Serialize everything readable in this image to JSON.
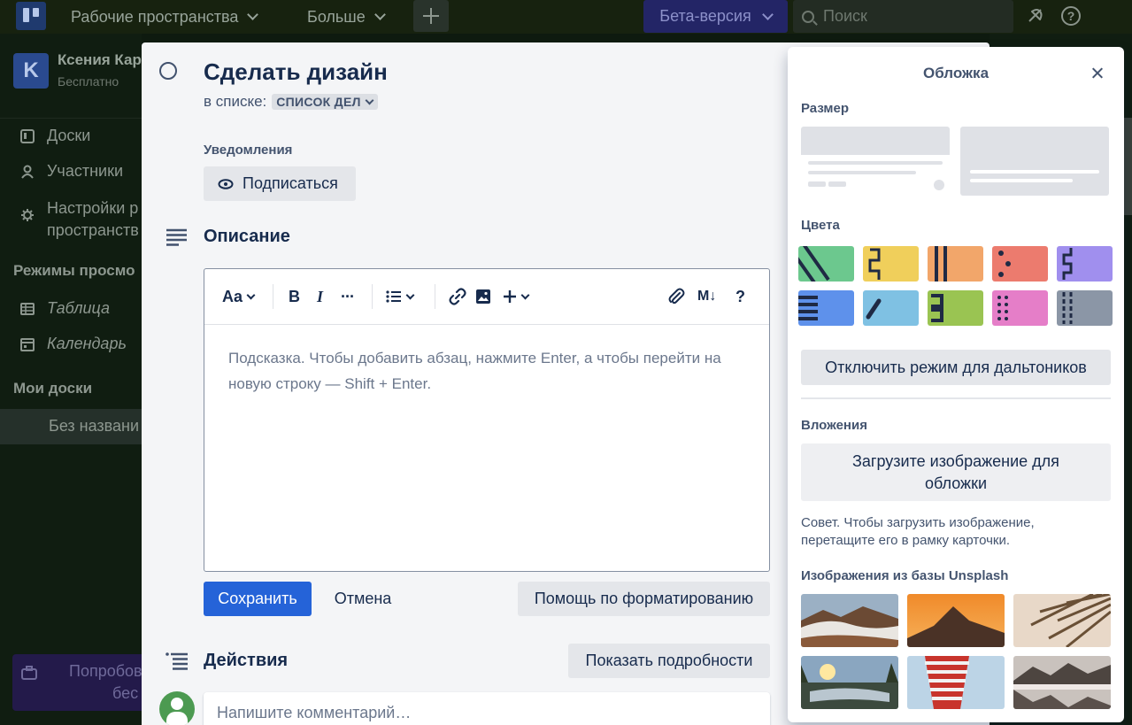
{
  "topbar": {
    "workspaces_label": "Рабочие пространства",
    "more_label": "Больше",
    "beta_label": "Бета-версия",
    "search_placeholder": "Поиск"
  },
  "sidebar": {
    "workspace_initial": "K",
    "workspace_name": "Ксения Кар",
    "workspace_plan": "Бесплатно",
    "items": [
      {
        "label": "Доски"
      },
      {
        "label": "Участники"
      },
      {
        "label_line1": "Настройки р",
        "label_line2": "пространств"
      }
    ],
    "views_section": "Режимы просмо",
    "views": [
      {
        "label": "Таблица"
      },
      {
        "label": "Календарь"
      }
    ],
    "boards_section": "Мои доски",
    "boards": [
      {
        "label": "Без названи"
      }
    ],
    "try_line1": "Попробов",
    "try_line2": "бес"
  },
  "card": {
    "title": "Сделать дизайн",
    "in_list_label": "в списке:",
    "list_name": "СПИСОК ДЕЛ",
    "notifications_label": "Уведомления",
    "subscribe_label": "Подписаться",
    "description_title": "Описание",
    "editor": {
      "text_style": "Aa",
      "bold": "B",
      "italic": "I",
      "more": "···",
      "markdown": "M↓",
      "help": "?",
      "placeholder": "Подсказка. Чтобы добавить абзац, нажмите Enter, а чтобы перейти на новую строку — Shift + Enter."
    },
    "save_label": "Сохранить",
    "cancel_label": "Отмена",
    "formatting_help_label": "Помощь по форматированию",
    "activity_title": "Действия",
    "show_details_label": "Показать подробности",
    "comment_placeholder": "Напишите комментарий…"
  },
  "cover": {
    "title": "Обложка",
    "size_label": "Размер",
    "colors_label": "Цвета",
    "colors": [
      "#6cc88e",
      "#f0cf5b",
      "#f2a66a",
      "#ec7b6e",
      "#a08fee",
      "#5e91eb",
      "#7fc1e3",
      "#9ac452",
      "#e57ec8",
      "#8b96a6"
    ],
    "colorblind_button": "Отключить режим для дальтоников",
    "attachments_label": "Вложения",
    "upload_button": "Загрузите изображение для обложки",
    "tip": "Совет. Чтобы загрузить изображение, перетащите его в рамку карточки.",
    "unsplash_label": "Изображения из базы Unsplash"
  }
}
